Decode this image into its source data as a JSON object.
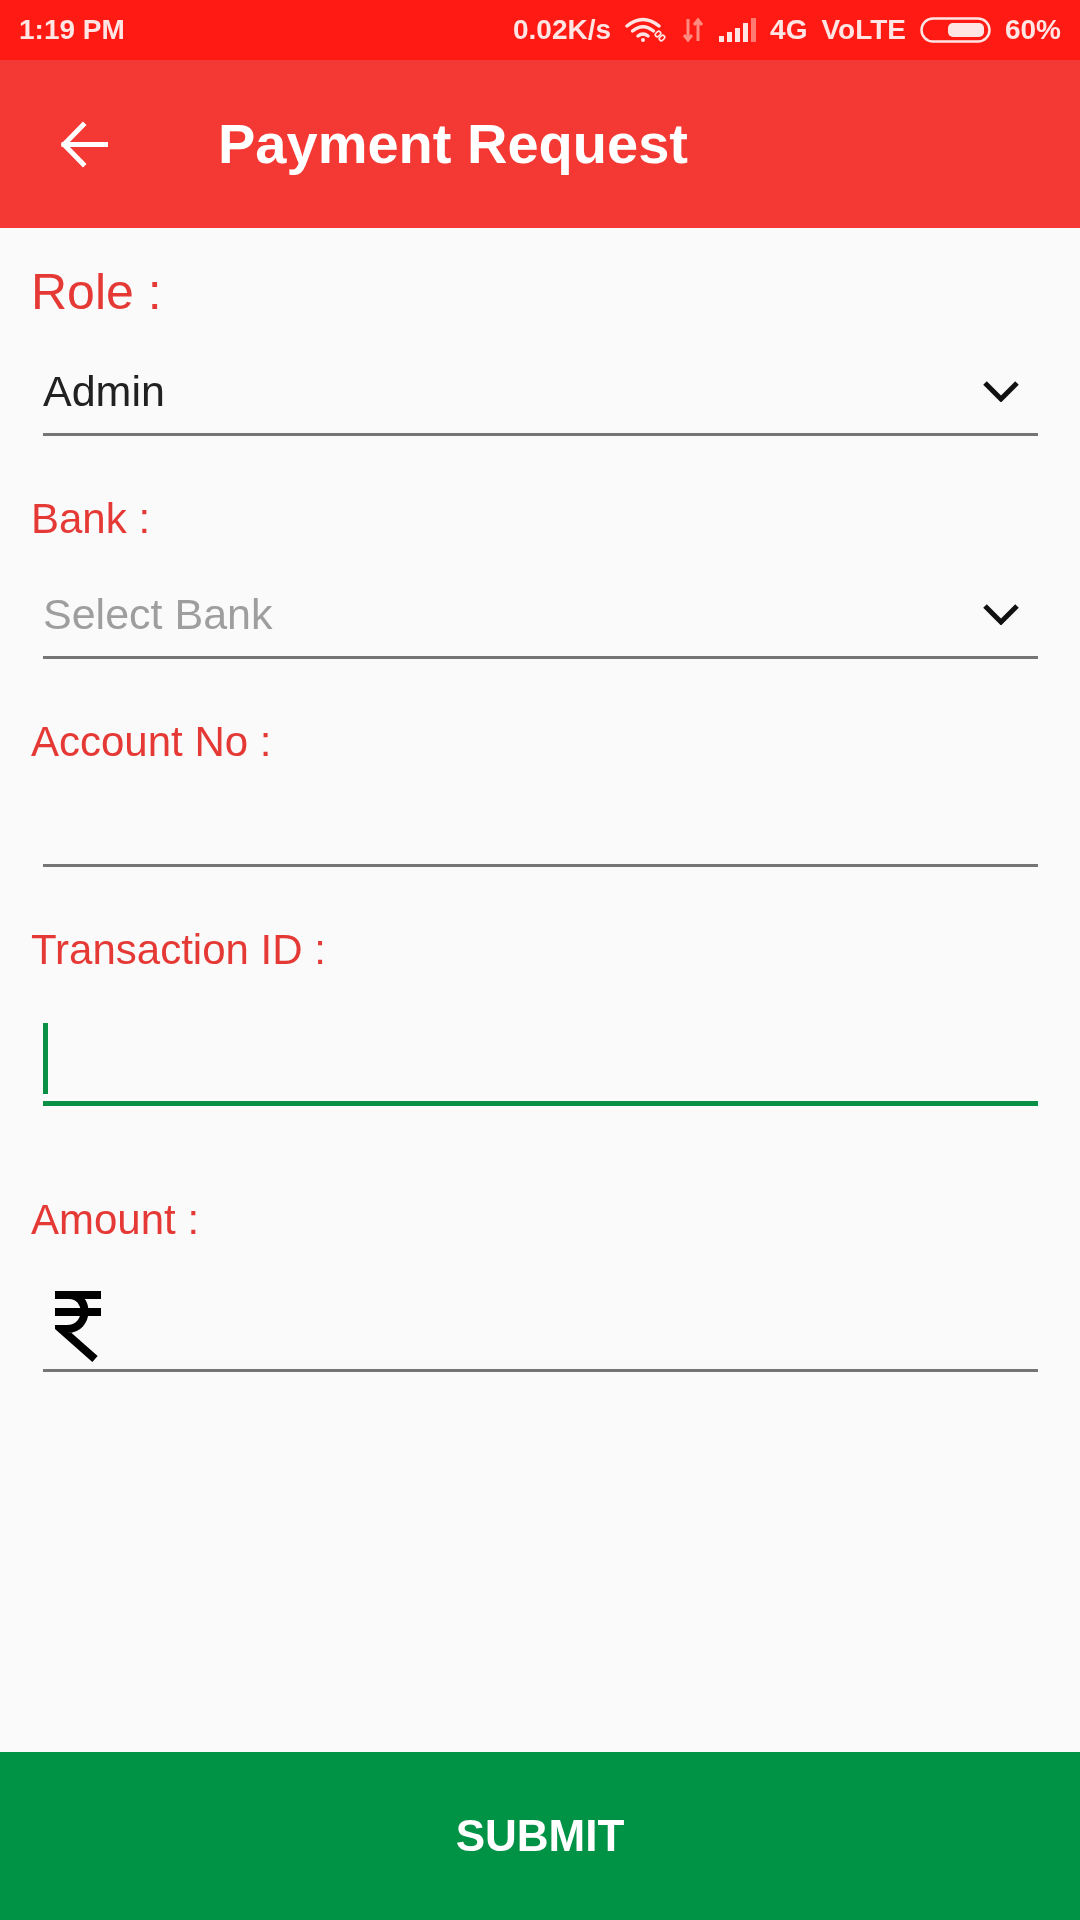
{
  "status_bar": {
    "time": "1:19 PM",
    "speed": "0.02K/s",
    "network_type": "4G",
    "volte": "VoLTE",
    "battery": "60%"
  },
  "app_bar": {
    "title": "Payment Request"
  },
  "fields": [
    {
      "kind": "dropdown",
      "label": "Role :",
      "value": "Admin",
      "focused": false
    },
    {
      "kind": "dropdown",
      "label": "Bank :",
      "placeholder": "Select Bank",
      "focused": false
    },
    {
      "kind": "text",
      "label": "Account No :",
      "focused": false
    },
    {
      "kind": "text",
      "label": "Transaction ID :",
      "focused": true
    },
    {
      "kind": "currency",
      "label": "Amount :",
      "focused": false
    }
  ],
  "submit_button": {
    "label": "SUBMIT"
  }
}
